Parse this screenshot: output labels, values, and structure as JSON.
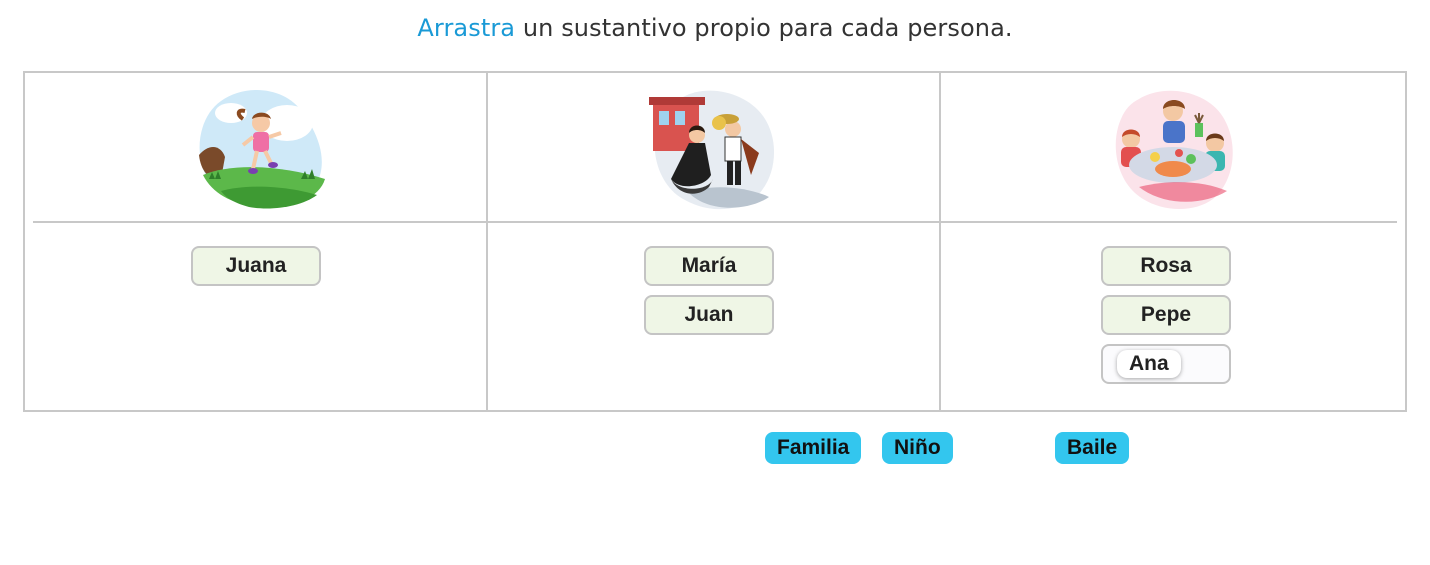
{
  "instruction": {
    "verb": "Arrastra",
    "rest": " un sustantivo propio para cada persona."
  },
  "columns": [
    {
      "image": "girl-jumping-outdoors-illustration",
      "answers": [
        "Juana"
      ]
    },
    {
      "image": "couple-dancing-illustration",
      "answers": [
        "María",
        "Juan"
      ]
    },
    {
      "image": "family-crafting-at-table-illustration",
      "answers": [
        "Rosa",
        "Pepe"
      ],
      "pending_chip": "Ana"
    }
  ],
  "word_bank": [
    "Familia",
    "Niño",
    "Baile"
  ],
  "colors": {
    "accent": "#1a9ad6",
    "slot_fill": "#eff6e6",
    "chip_fill": "#33c6ee",
    "border": "#c8c8c8"
  }
}
